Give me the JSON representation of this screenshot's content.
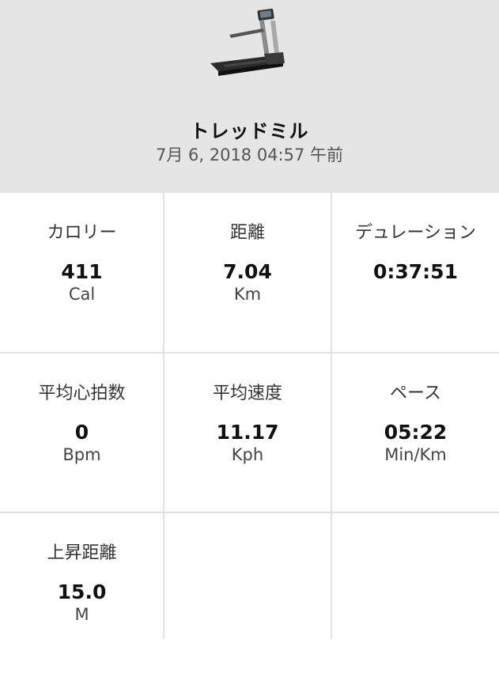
{
  "header": {
    "device_icon": "treadmill-icon",
    "title": "トレッドミル",
    "datetime": "7月 6, 2018 04:57 午前"
  },
  "stats": [
    {
      "label": "カロリー",
      "value": "411",
      "unit": "Cal"
    },
    {
      "label": "距離",
      "value": "7.04",
      "unit": "Km"
    },
    {
      "label": "デュレーション",
      "value": "0:37:51",
      "unit": ""
    },
    {
      "label": "平均心拍数",
      "value": "0",
      "unit": "Bpm"
    },
    {
      "label": "平均速度",
      "value": "11.17",
      "unit": "Kph"
    },
    {
      "label": "ペース",
      "value": "05:22",
      "unit": "Min/Km"
    },
    {
      "label": "上昇距離",
      "value": "15.0",
      "unit": "M"
    }
  ]
}
